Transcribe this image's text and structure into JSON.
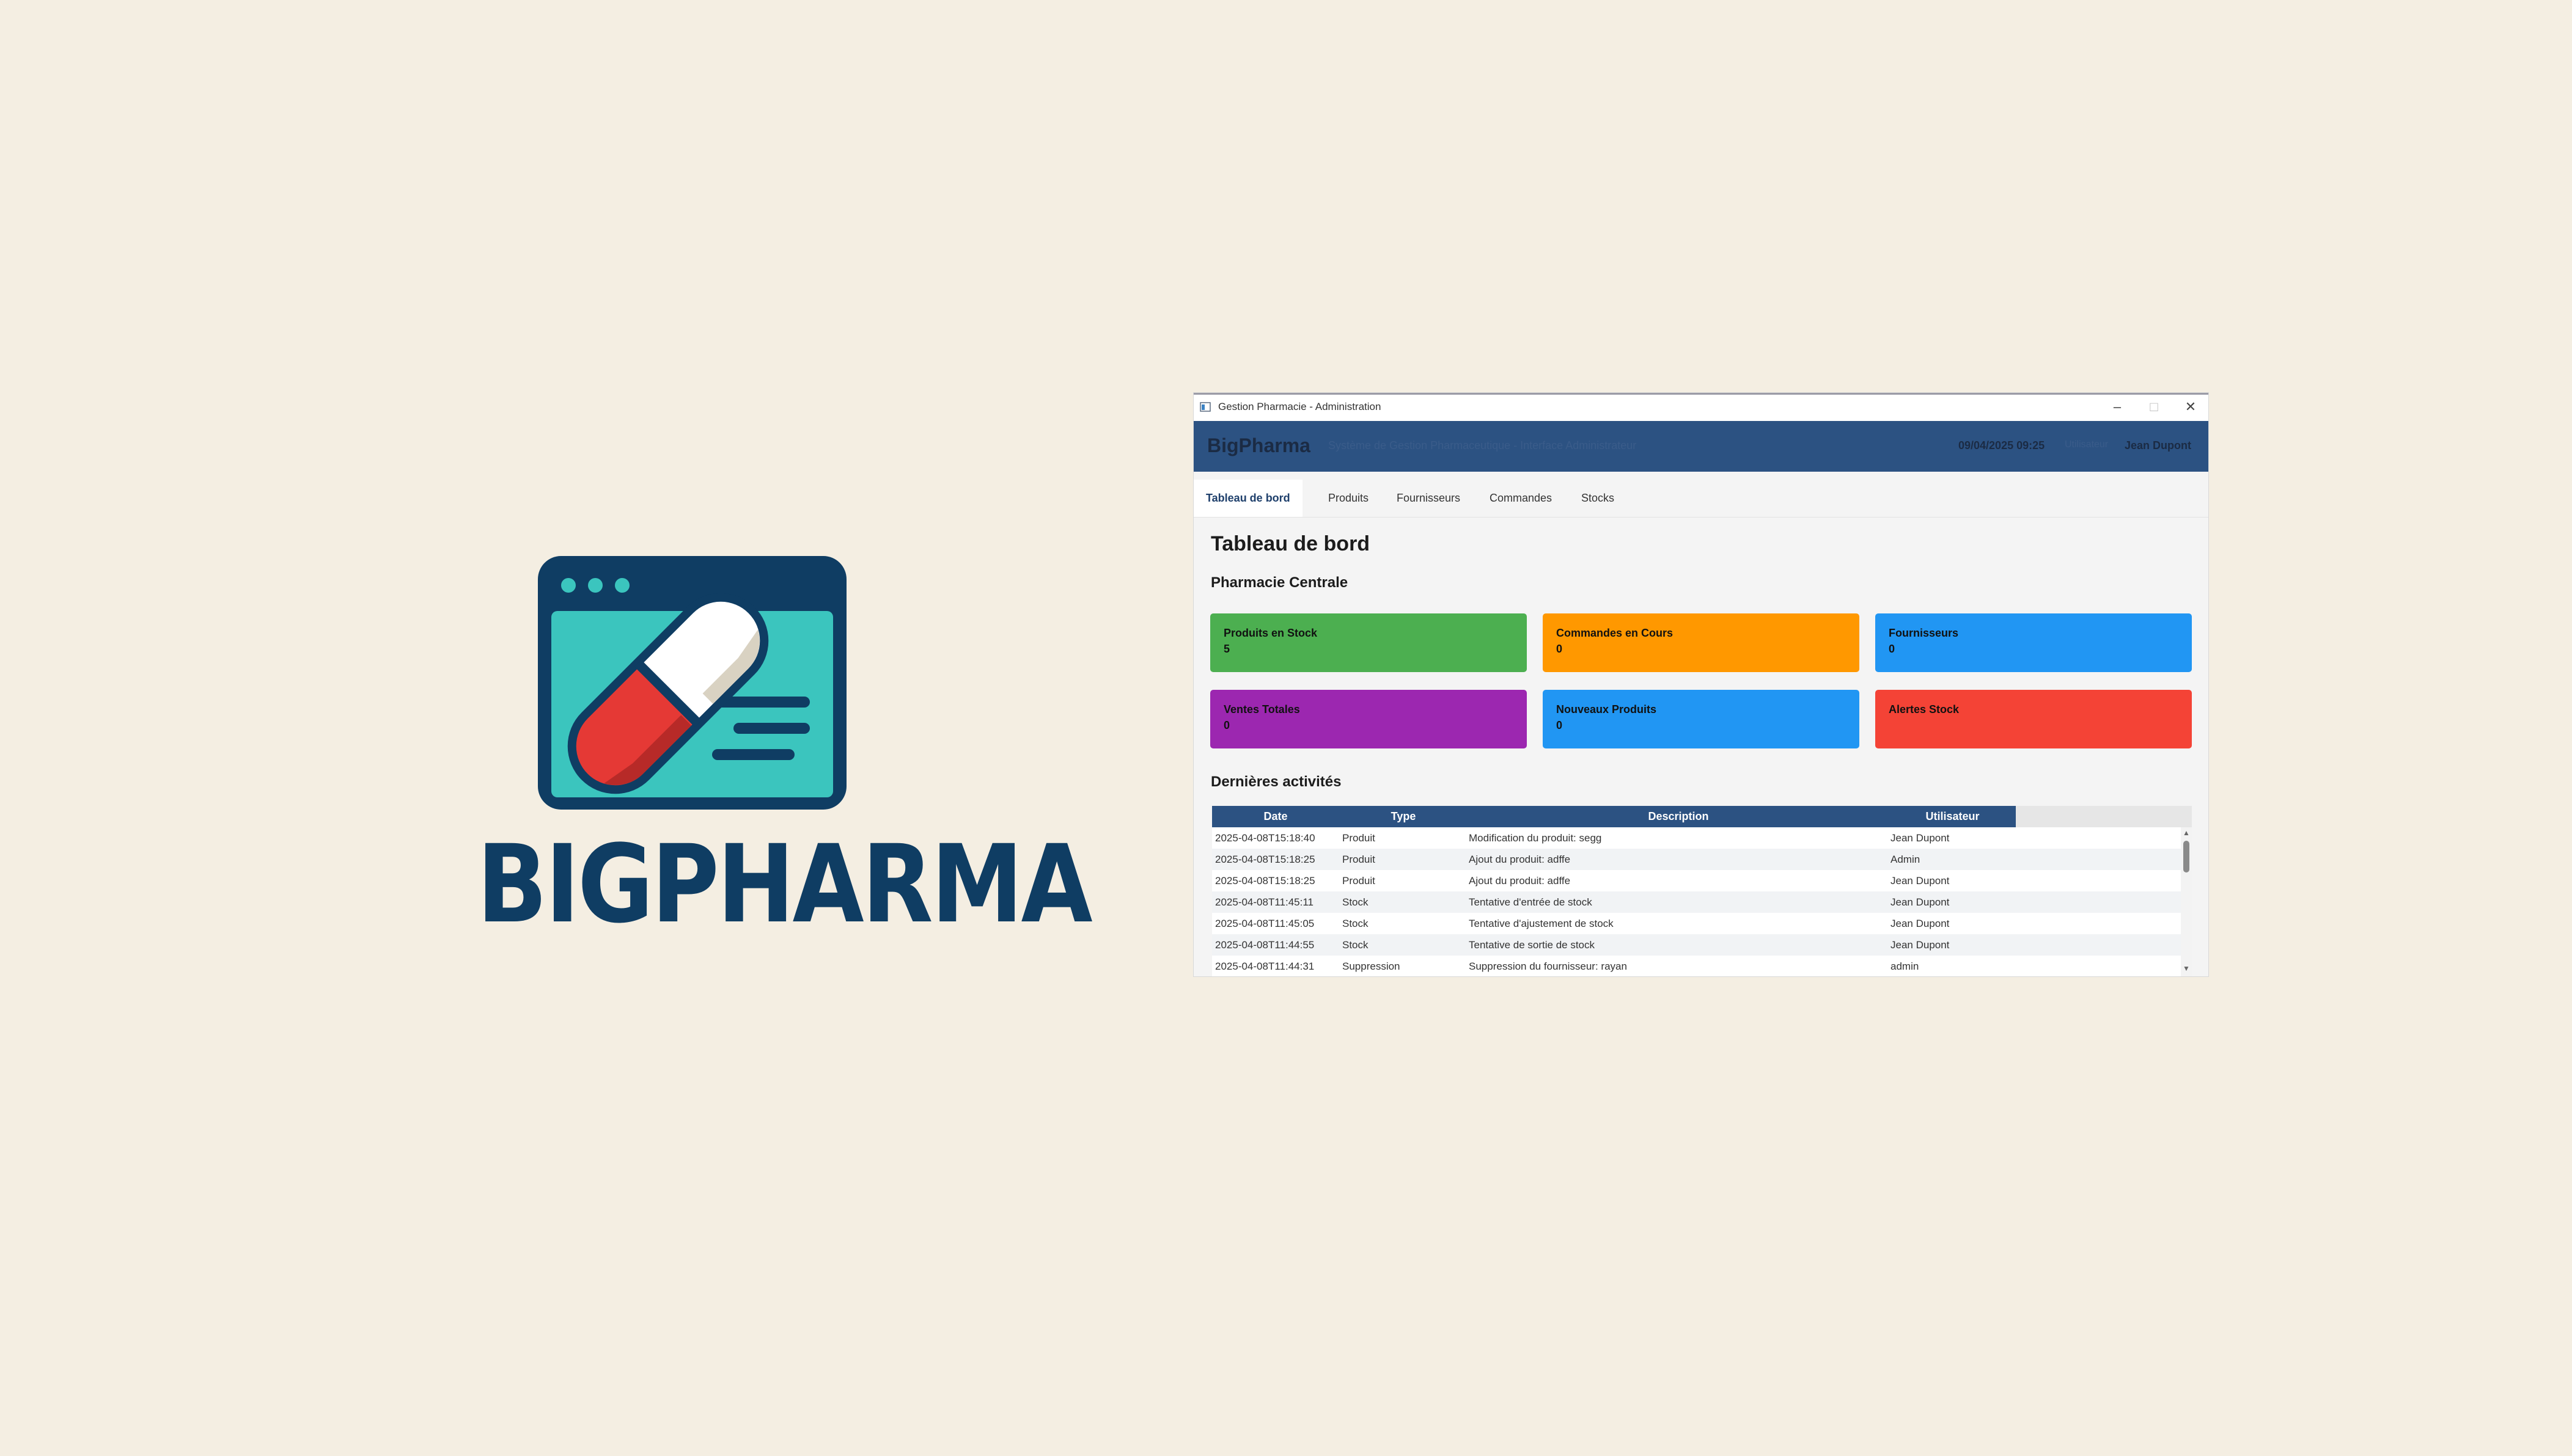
{
  "logo": {
    "wordmark": "BIGPHARMA",
    "colors": {
      "navy": "#0F3D63",
      "teal": "#3BC5BE",
      "red": "#E53935",
      "white": "#FFFFFF"
    }
  },
  "window": {
    "title": "Gestion Pharmacie - Administration",
    "controls": {
      "minimize": "–",
      "maximize": "□",
      "close": "✕"
    }
  },
  "header": {
    "brand": "BigPharma",
    "subtitle": "Système de Gestion Pharmaceutique - Interface Administrateur",
    "datetime": "09/04/2025 09:25",
    "role_label": "Utilisateur",
    "user": "Jean Dupont",
    "bg_color": "#2C5282"
  },
  "tabs": [
    {
      "label": "Tableau de bord",
      "active": true
    },
    {
      "label": "Produits",
      "active": false
    },
    {
      "label": "Fournisseurs",
      "active": false
    },
    {
      "label": "Commandes",
      "active": false
    },
    {
      "label": "Stocks",
      "active": false
    }
  ],
  "dashboard": {
    "title": "Tableau de bord",
    "pharmacy_name": "Pharmacie Centrale",
    "cards": [
      {
        "label": "Produits en Stock",
        "value": "5",
        "color": "#4CAF50"
      },
      {
        "label": "Commandes en Cours",
        "value": "0",
        "color": "#FF9800"
      },
      {
        "label": "Fournisseurs",
        "value": "0",
        "color": "#2196F3"
      },
      {
        "label": "Ventes Totales",
        "value": "0",
        "color": "#9C27B0"
      },
      {
        "label": "Nouveaux Produits",
        "value": "0",
        "color": "#2196F3"
      },
      {
        "label": "Alertes Stock",
        "value": "",
        "color": "#F44336"
      }
    ],
    "activities_title": "Dernières activités"
  },
  "activities": {
    "columns": [
      "Date",
      "Type",
      "Description",
      "Utilisateur"
    ],
    "rows": [
      [
        "2025-04-08T15:18:40",
        "Produit",
        "Modification du produit: segg",
        "Jean Dupont"
      ],
      [
        "2025-04-08T15:18:25",
        "Produit",
        "Ajout du produit: adffe",
        "Admin"
      ],
      [
        "2025-04-08T15:18:25",
        "Produit",
        "Ajout du produit: adffe",
        "Jean Dupont"
      ],
      [
        "2025-04-08T11:45:11",
        "Stock",
        "Tentative d'entrée de stock",
        "Jean Dupont"
      ],
      [
        "2025-04-08T11:45:05",
        "Stock",
        "Tentative d'ajustement de stock",
        "Jean Dupont"
      ],
      [
        "2025-04-08T11:44:55",
        "Stock",
        "Tentative de sortie de stock",
        "Jean Dupont"
      ],
      [
        "2025-04-08T11:44:31",
        "Suppression",
        "Suppression du fournisseur: rayan",
        "admin"
      ]
    ]
  }
}
